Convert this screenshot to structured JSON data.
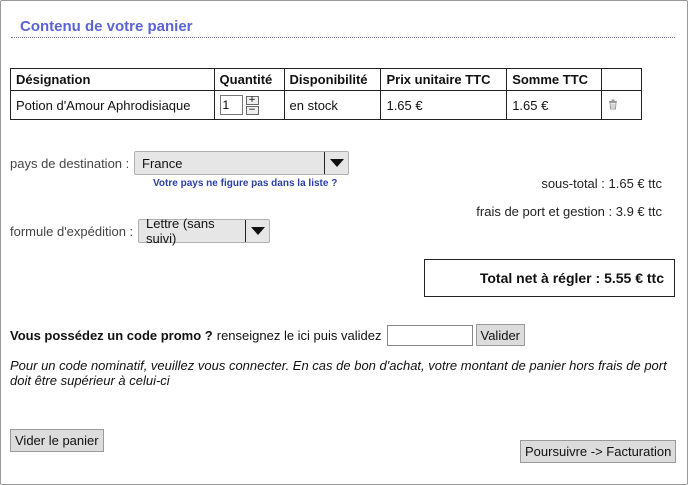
{
  "title": "Contenu de votre panier",
  "table": {
    "headers": [
      "Désignation",
      "Quantité",
      "Disponibilité",
      "Prix unitaire TTC",
      "Somme TTC",
      ""
    ],
    "rows": [
      {
        "designation": "Potion d'Amour Aphrodisiaque",
        "quantity": "1",
        "availability": "en stock",
        "unit_price": "1.65 €",
        "total": "1.65 €",
        "plus": "+",
        "minus": "−"
      }
    ]
  },
  "destination": {
    "label": "pays de destination :",
    "value": "France",
    "missing_link": "Votre pays ne figure pas dans la liste ?"
  },
  "shipping": {
    "label": "formule d'expédition :",
    "value": "Lettre (sans suivi)"
  },
  "summary": {
    "subtotal": "sous-total : 1.65 € ttc",
    "shipping_fees": "frais de port et gestion : 3.9 € ttc",
    "total": "Total net à régler : 5.55 € ttc"
  },
  "promo": {
    "question": "Vous possédez un code promo ?",
    "instruction": "renseignez le ici puis validez",
    "input_value": "",
    "button": "Valider"
  },
  "note": "Pour un code nominatif, veuillez vous connecter. En cas de bon d'achat, votre montant de panier hors frais de port doit être supérieur à celui-ci",
  "buttons": {
    "empty_cart": "Vider le panier",
    "continue": "Poursuivre -> Facturation"
  }
}
